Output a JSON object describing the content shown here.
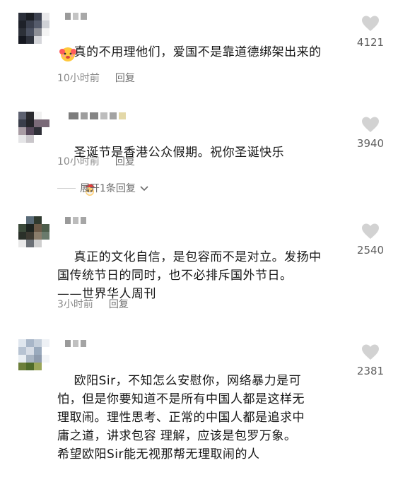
{
  "comments": [
    {
      "text": "真的不用理他们，爱国不是靠道德绑架出来的",
      "emoji": "red-face-emoji",
      "time": "10小时前",
      "reply": "回复",
      "likes": "4121"
    },
    {
      "text": "圣诞节是香港公众假期。祝你圣诞快乐",
      "emoji": "santa-emoji",
      "time": "10小时前",
      "reply": "回复",
      "likes": "3940"
    },
    {
      "text": "真正的文化自信，是包容而不是对立。发扬中\n国传统节日的同时，也不必排斥国外节日。\n——世界华人周刊",
      "time": "3小时前",
      "reply": "回复",
      "likes": "2540"
    },
    {
      "text": "欧阳Sir，不知怎么安慰你，网络暴力是可\n怕，但是你要知道不是所有中国人都是这样无\n理取闹。理性思考、正常的中国人都是追求中\n庸之道，讲求包容 理解，应该是包罗万象。\n希望欧阳Sir能无视那帮无理取闹的人",
      "likes": "2381"
    }
  ],
  "expand_replies": "展开1条回复",
  "icons": {
    "like": "heart-icon",
    "expand": "chevron-down-icon"
  },
  "colors": {
    "heart": "#cfcfcf",
    "meta": "#8a8a8a"
  }
}
